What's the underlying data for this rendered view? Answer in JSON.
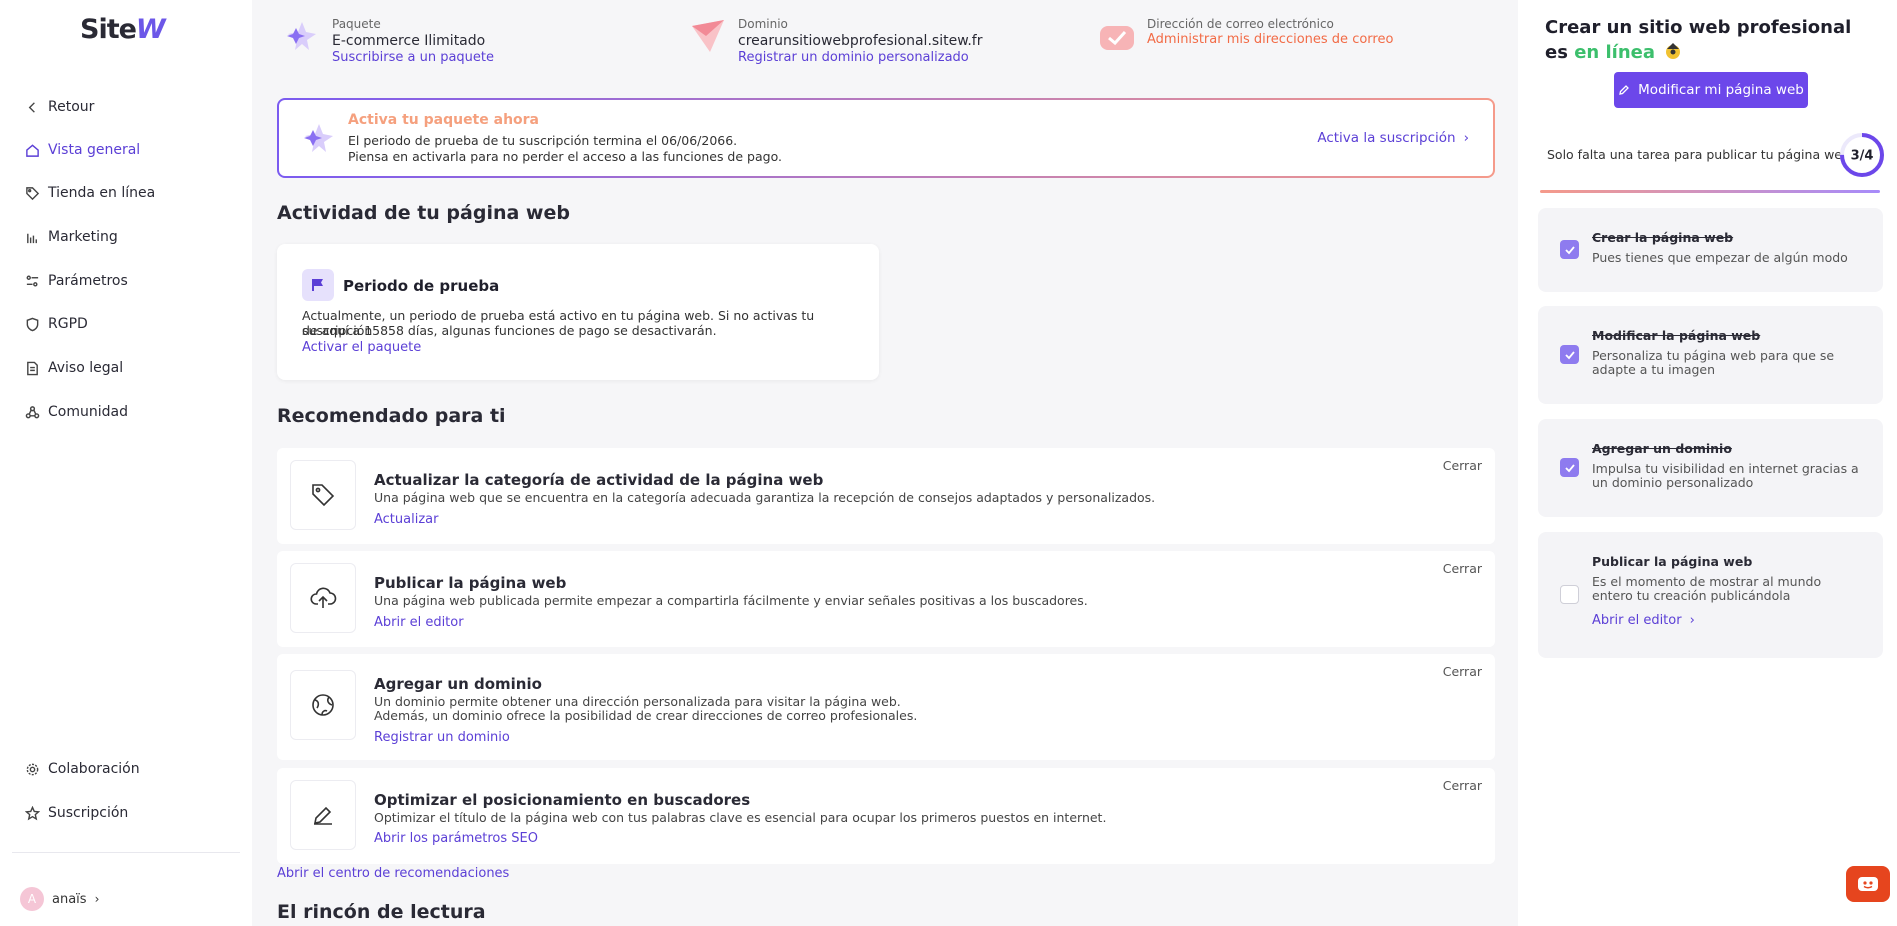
{
  "logo": {
    "main": "Site",
    "accent": "W"
  },
  "sidebar": {
    "back": "Retour",
    "items": [
      {
        "label": "Vista general",
        "icon": "home-icon",
        "active": true
      },
      {
        "label": "Tienda en línea",
        "icon": "tag-icon"
      },
      {
        "label": "Marketing",
        "icon": "bar-chart-icon"
      },
      {
        "label": "Parámetros",
        "icon": "sliders-icon"
      },
      {
        "label": "RGPD",
        "icon": "shield-icon"
      },
      {
        "label": "Aviso legal",
        "icon": "document-icon"
      },
      {
        "label": "Comunidad",
        "icon": "community-icon"
      }
    ],
    "bottom_items": [
      {
        "label": "Colaboración",
        "icon": "gear-icon"
      },
      {
        "label": "Suscripción",
        "icon": "star-icon"
      }
    ],
    "user": {
      "initial": "A",
      "name": "anaïs"
    }
  },
  "info": {
    "package": {
      "label": "Paquete",
      "value": "E-commerce Ilimitado",
      "link": "Suscribirse a un paquete"
    },
    "domain": {
      "label": "Dominio",
      "value": "crearunsitiowebprofesional.sitew.fr",
      "link": "Registrar un dominio personalizado"
    },
    "email": {
      "label": "Dirección de correo electrónico",
      "link": "Administrar mis direcciones de correo"
    }
  },
  "banner": {
    "title": "Activa tu paquete ahora",
    "line1": "El periodo de prueba de tu suscripción termina el 06/06/2066.",
    "line2": "Piensa en activarla para no perder el acceso a las funciones de pago.",
    "cta": "Activa la suscripción"
  },
  "activity": {
    "heading": "Actividad de tu página web",
    "trial": {
      "title": "Periodo de prueba",
      "line1": "Actualmente, un periodo de prueba está activo en tu página web. Si no activas tu suscripción",
      "line2": "de aquí a 15858 días, algunas funciones de pago se desactivarán.",
      "link": "Activar el paquete"
    }
  },
  "recommended": {
    "heading": "Recomendado para ti",
    "close_label": "Cerrar",
    "items": [
      {
        "icon": "tag-icon",
        "title": "Actualizar la categoría de actividad de la página web",
        "desc1": "Una página web que se encuentra en la categoría adecuada garantiza la recepción de consejos adaptados y personalizados.",
        "desc2": "",
        "link": "Actualizar"
      },
      {
        "icon": "upload-cloud-icon",
        "title": "Publicar la página web",
        "desc1": "Una página web publicada permite empezar a compartirla fácilmente y enviar señales positivas a los buscadores.",
        "desc2": "",
        "link": "Abrir el editor"
      },
      {
        "icon": "globe-icon",
        "title": "Agregar un dominio",
        "desc1": "Un dominio permite obtener una dirección personalizada para visitar la página web.",
        "desc2": "Además, un dominio ofrece la posibilidad de crear direcciones de correo profesionales.",
        "link": "Registrar un dominio"
      },
      {
        "icon": "pencil-icon",
        "title": "Optimizar el posicionamiento en buscadores",
        "desc1": "Optimizar el título de la página web con tus palabras clave es esencial para ocupar los primeros puestos en internet.",
        "desc2": "",
        "link": "Abrir los parámetros SEO"
      }
    ],
    "center_link": "Abrir el centro de recomendaciones"
  },
  "reading": {
    "heading": "El rincón de lectura"
  },
  "panel": {
    "heading_part1": "Crear un sitio web profesional es",
    "heading_green": "en línea",
    "edit_button": "Modificar mi página web",
    "progress_text": "Solo falta una tarea para publicar tu página web",
    "progress_label": "3/4",
    "progress_fraction": 0.75,
    "tasks": [
      {
        "title": "Crear la página web",
        "desc": "Pues tienes que empezar de algún modo",
        "done": true
      },
      {
        "title": "Modificar la página web",
        "desc": "Personaliza tu página web para que se adapte a tu imagen",
        "done": true
      },
      {
        "title": "Agregar un dominio",
        "desc": "Impulsa tu visibilidad en internet gracias a un dominio personalizado",
        "done": true
      },
      {
        "title": "Publicar la página web",
        "desc": "Es el momento de mostrar al mundo entero tu creación publicándola",
        "done": false,
        "link": "Abrir el editor"
      }
    ]
  },
  "colors": {
    "accent": "#5b3fd6",
    "button": "#6c47ea",
    "green": "#3cbf6c",
    "orange": "#f26b46",
    "chat": "#e6451e"
  }
}
